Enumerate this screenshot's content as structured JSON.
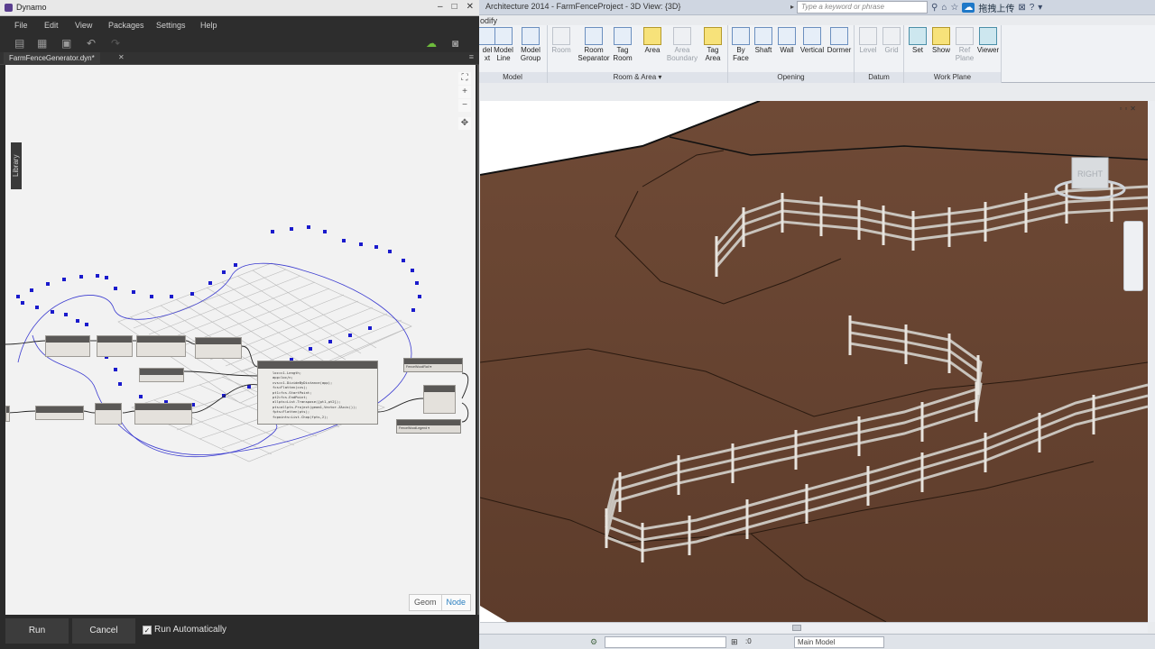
{
  "revit": {
    "title": "Architecture 2014 -    FarmFenceProject - 3D View: {3D}",
    "search_placeholder": "Type a keyword or phrase",
    "upload_label": "拖拽上传",
    "modify_tab": "odify",
    "panels": [
      {
        "label": "Model"
      },
      {
        "label": "Room & Area ▾"
      },
      {
        "label": "Opening"
      },
      {
        "label": "Datum"
      },
      {
        "label": "Work Plane"
      }
    ],
    "tools": [
      {
        "label": "del\nxt",
        "disabled": false
      },
      {
        "label": "Model\nLine",
        "disabled": false
      },
      {
        "label": "Model\nGroup",
        "disabled": false
      },
      {
        "label": "Room",
        "disabled": true
      },
      {
        "label": "Room\nSeparator",
        "disabled": false
      },
      {
        "label": "Tag\nRoom",
        "disabled": false
      },
      {
        "label": "Area",
        "disabled": false
      },
      {
        "label": "Area\nBoundary",
        "disabled": true
      },
      {
        "label": "Tag\nArea",
        "disabled": false
      },
      {
        "label": "By\nFace",
        "disabled": false
      },
      {
        "label": "Shaft",
        "disabled": false
      },
      {
        "label": "Wall",
        "disabled": false
      },
      {
        "label": "Vertical",
        "disabled": false
      },
      {
        "label": "Dormer",
        "disabled": false
      },
      {
        "label": "Level",
        "disabled": true
      },
      {
        "label": "Grid",
        "disabled": true
      },
      {
        "label": "Set",
        "disabled": false
      },
      {
        "label": "Show",
        "disabled": false
      },
      {
        "label": "Ref\nPlane",
        "disabled": true
      },
      {
        "label": "Viewer",
        "disabled": false
      }
    ],
    "viewcube_label": "RIGHT",
    "status": {
      "zero": ":0",
      "model": "Main Model"
    }
  },
  "dynamo": {
    "title": "Dynamo",
    "menus": [
      "File",
      "Edit",
      "View",
      "Packages",
      "Settings",
      "Help"
    ],
    "tab_name": "FarmFenceGenerator.dyn*",
    "library_label": "Library",
    "code_block": "loc=c1.Length;\napp=loc/n;\ncvs=c1.DivideByDistance(app);\nfcs=Flatten(cvs);\npt1=fcs.StartPoint;\npt2=fcs.EndPoint;\nallpts=List.Transpose({pt1,pt2});\npts=allpts.Project(geom1,Vector.ZAxis());\nfpts=Flatten(pts);\nfcpoints=List.Chop(fpts,2);",
    "dropdown1": "FenceWoodRail ▾",
    "dropdown2": "FenceWoodLegend ▾",
    "view_toggle": {
      "geom": "Geom",
      "node": "Node"
    },
    "run_label": "Run",
    "cancel_label": "Cancel",
    "run_auto_label": "Run Automatically",
    "run_auto_checked": "✓"
  }
}
